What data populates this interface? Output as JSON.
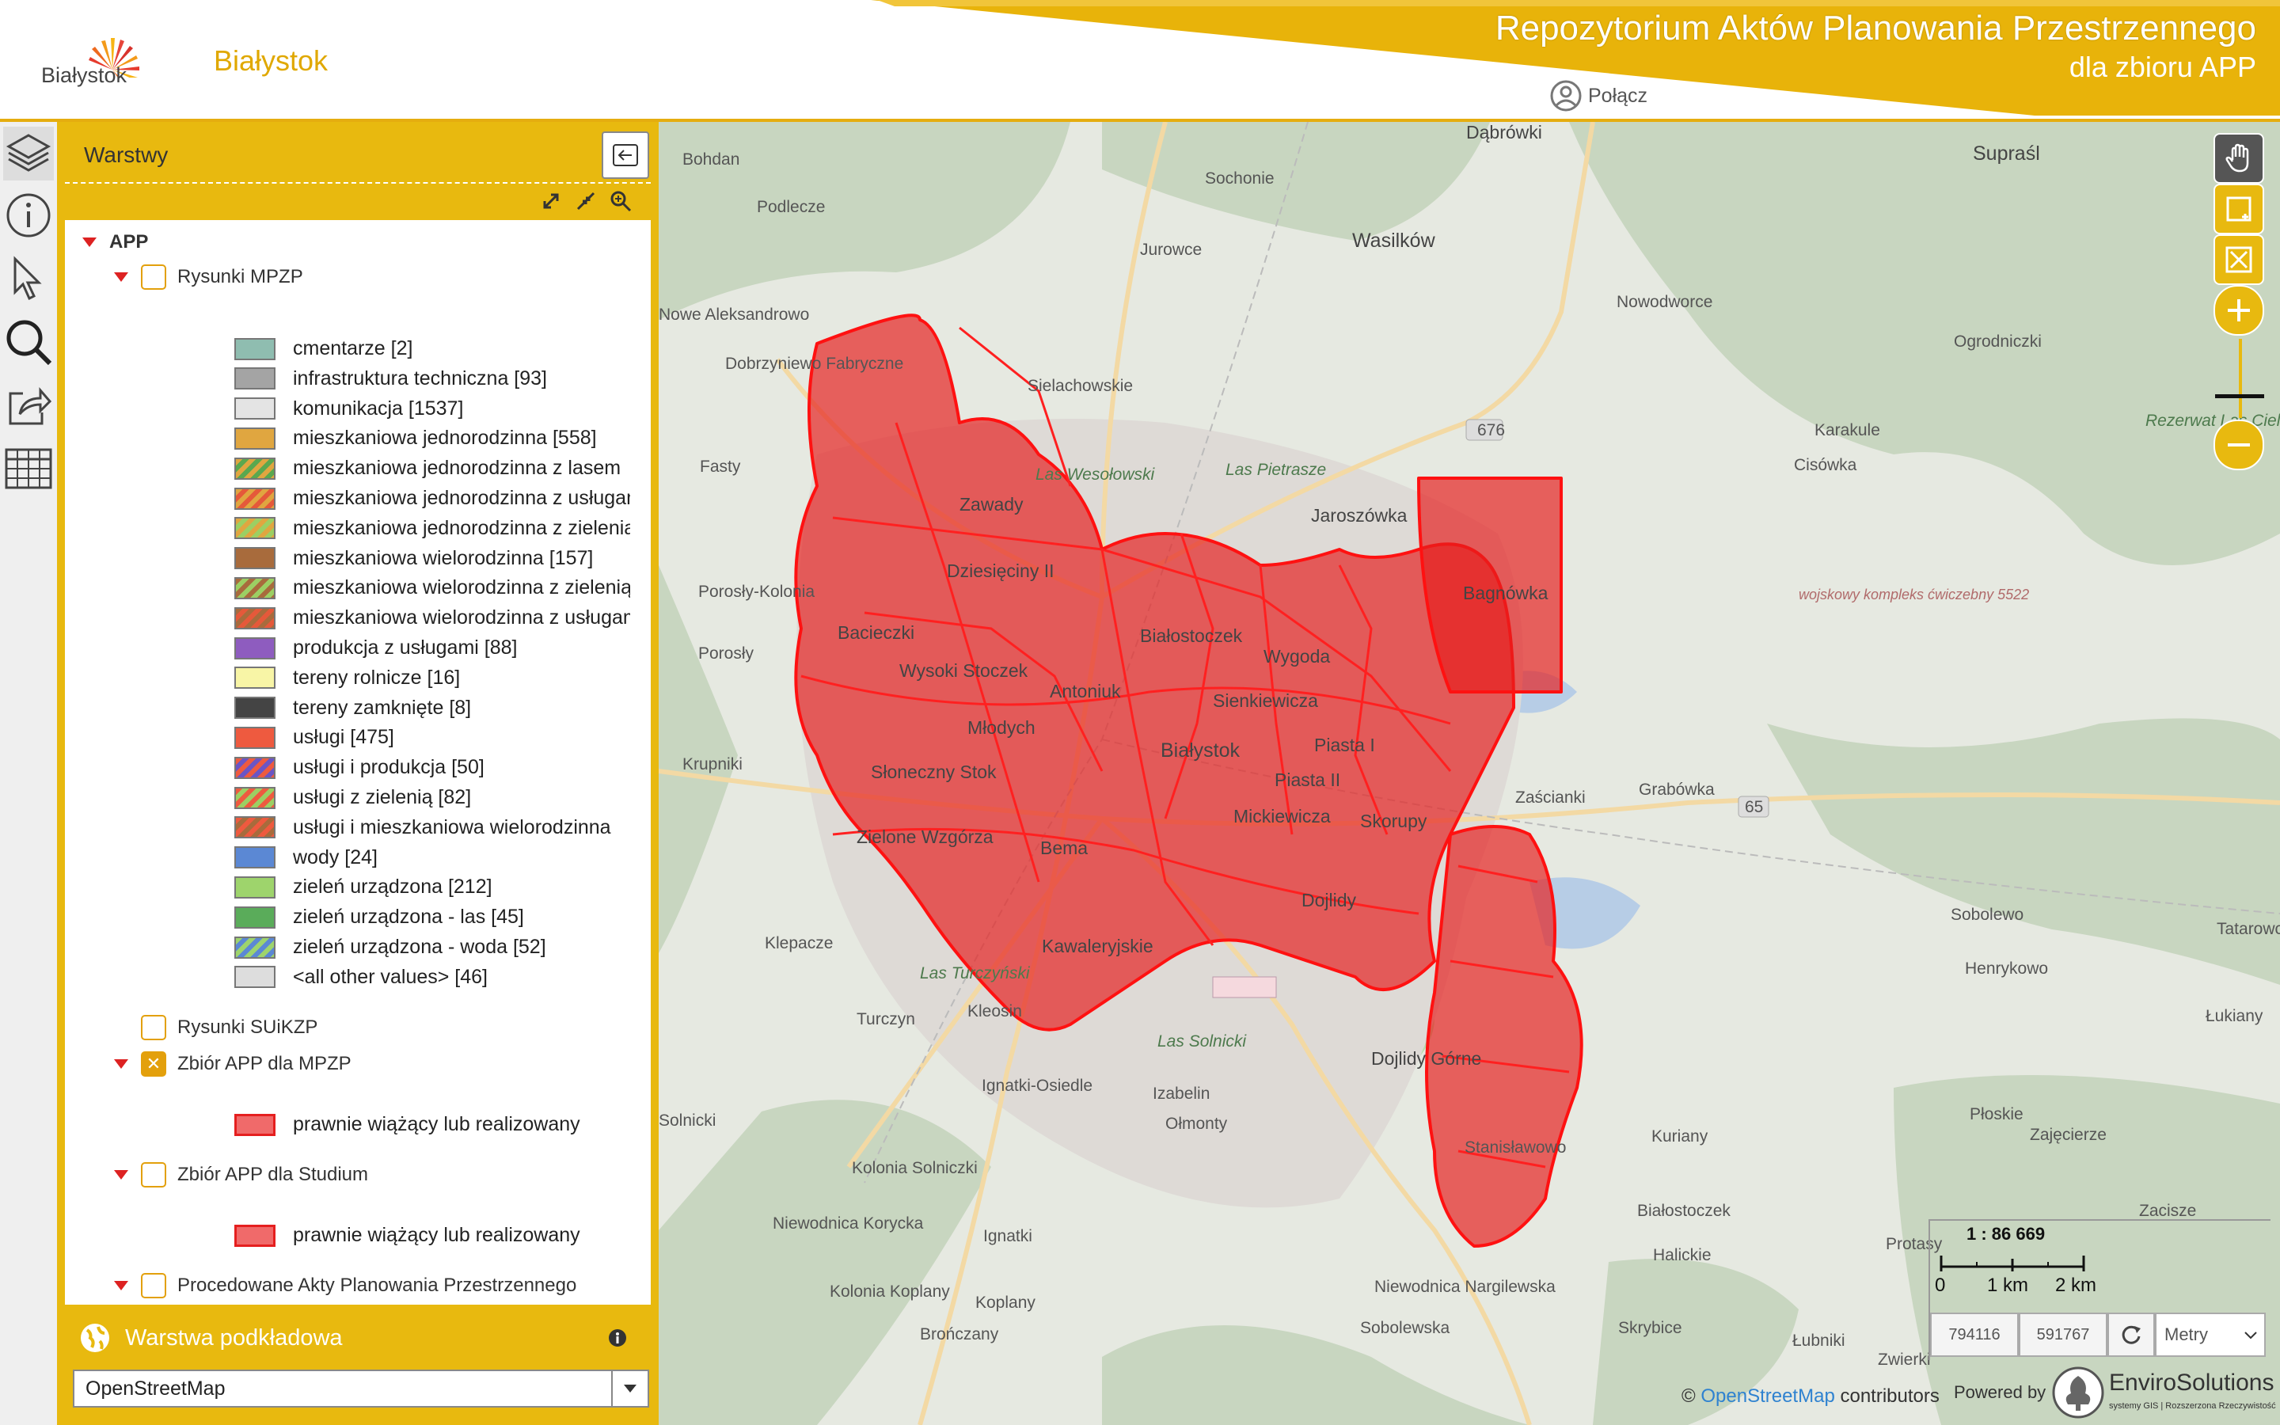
{
  "header": {
    "logo_text": "Białystok",
    "city_name": "Białystok",
    "title": "Repozytorium Aktów Planowania Przestrzennego",
    "subtitle": "dla zbioru APP",
    "login_label": "Połącz"
  },
  "toolbar": {
    "buttons": [
      "layers-icon",
      "info-icon",
      "select-icon",
      "search-icon",
      "share-icon",
      "table-icon"
    ]
  },
  "layers_panel": {
    "title": "Warstwy",
    "root": "APP",
    "groups": [
      {
        "label": "Rysunki MPZP",
        "checked": false,
        "expanded": true
      },
      {
        "label": "Rysunki SUiKZP",
        "checked": false,
        "expanded": false
      },
      {
        "label": "Zbiór APP dla MPZP",
        "checked": true,
        "expanded": true
      },
      {
        "label": "Zbiór APP dla Studium",
        "checked": false,
        "expanded": true
      },
      {
        "label": "Procedowane Akty Planowania Przestrzennego",
        "checked": false,
        "expanded": true
      }
    ],
    "legend_mpzp": [
      {
        "label": "cmentarze [2]",
        "color": "#8fbdb0"
      },
      {
        "label": "infrastruktura techniczna [93]",
        "color": "#a4a4a4"
      },
      {
        "label": "komunikacja [1537]",
        "color": "#e4e4e4"
      },
      {
        "label": "mieszkaniowa jednorodzinna [558]",
        "color": "#e0a640"
      },
      {
        "label": "mieszkaniowa jednorodzinna z lasem",
        "color": "#e0a640",
        "stripe": "#5aa84f"
      },
      {
        "label": "mieszkaniowa jednorodzinna z usługami",
        "color": "#e0a640",
        "stripe": "#e5593a"
      },
      {
        "label": "mieszkaniowa jednorodzinna z zielenią",
        "color": "#e0a640",
        "stripe": "#9ccf63"
      },
      {
        "label": "mieszkaniowa wielorodzinna [157]",
        "color": "#a86b3c"
      },
      {
        "label": "mieszkaniowa wielorodzinna z zielenią",
        "color": "#a86b3c",
        "stripe": "#9ccf63"
      },
      {
        "label": "mieszkaniowa wielorodzinna z usługami",
        "color": "#a86b3c",
        "stripe": "#e5593a"
      },
      {
        "label": "produkcja z usługami [88]",
        "color": "#8e5cbf"
      },
      {
        "label": "tereny rolnicze [16]",
        "color": "#f8f5a6"
      },
      {
        "label": "tereny zamknięte [8]",
        "color": "#444444"
      },
      {
        "label": "usługi [475]",
        "color": "#ee5a3f"
      },
      {
        "label": "usługi i produkcja [50]",
        "color": "#ee5a3f",
        "stripe": "#6b55c4"
      },
      {
        "label": "usługi z zielenią [82]",
        "color": "#ee5a3f",
        "stripe": "#9ccf63"
      },
      {
        "label": "usługi i mieszkaniowa wielorodzinna",
        "color": "#ee5a3f",
        "stripe": "#a86b3c"
      },
      {
        "label": "wody [24]",
        "color": "#5b88d4"
      },
      {
        "label": "zieleń urządzona [212]",
        "color": "#9ed46c"
      },
      {
        "label": "zieleń urządzona - las [45]",
        "color": "#5aac5a"
      },
      {
        "label": "zieleń urządzona - woda [52]",
        "color": "#9ed46c",
        "stripe": "#5b88d4"
      },
      {
        "label": "<all other values> [46]",
        "color": "#dddddd"
      }
    ],
    "legend_app_mpzp": {
      "label": "prawnie wiążący lub realizowany",
      "color": "#f06a6a"
    },
    "legend_app_studium": {
      "label": "prawnie wiążący lub realizowany",
      "color": "#f06a6a"
    }
  },
  "basemap": {
    "title": "Warstwa podkładowa",
    "selected": "OpenStreetMap"
  },
  "map": {
    "places": [
      "Dąbrówki",
      "Supraśl",
      "Bohdan",
      "Sochonie",
      "Podlecze",
      "Wasilków",
      "Jurowce",
      "Nowe Aleksandrowo",
      "Nowodworce",
      "Ogrodniczki",
      "Dobrzyniewo Fabryczne",
      "Sielachowskie",
      "Fasty",
      "Karakule",
      "Cisówka",
      "Las Wesołowski",
      "Las Pietrasze",
      "Jaroszówka",
      "Zawady",
      "Dziesięciny II",
      "Bagnówka",
      "Porosły-Kolonia",
      "Białostoczek",
      "Wygoda",
      "Bacieczki",
      "Porosły",
      "Wysoki Stoczek",
      "Antoniuk",
      "Sienkiewicza",
      "Młodych",
      "Białystok",
      "Piasta I",
      "Piasta II",
      "Krupniki",
      "Słoneczny Stok",
      "Zaścianki",
      "Grabówka",
      "Zielone Wzgórza",
      "Mickiewicza",
      "Skorupy",
      "Bema",
      "Sobolewo",
      "Tatarowce",
      "Klepacze",
      "Dojlidy",
      "Kawaleryjskie",
      "Henrykowo",
      "Las Turczyński",
      "Kleosin",
      "Łukiany",
      "Turczyn",
      "Las Solnicki",
      "Dojlidy Górne",
      "Ignatki-Osiedle",
      "Izabelin",
      "Płoskie",
      "Solnicki",
      "Ołmonty",
      "Kuriany",
      "Zajęcierze",
      "Stanisławowo",
      "Kolonia Solniczki",
      "Zacisze",
      "Białostoczek",
      "Halickie",
      "Protasy",
      "Niewodnica Korycka",
      "Ignatki",
      "Kolonia Koplany",
      "Niewodnica Nargilewska",
      "Koplany",
      "Sobolewska",
      "Brończany",
      "Skrybice",
      "Łubniki",
      "Zwierki",
      "Rezerwat Las Cieliczanski",
      "wojskowy kompleks ćwiczebny 5522"
    ],
    "road_numbers": [
      "676",
      "65"
    ]
  },
  "scale": {
    "ratio": "1 : 86 669",
    "labels": [
      "0",
      "1 km",
      "2 km"
    ],
    "coord_x": "794116",
    "coord_y": "591767",
    "units": "Metry"
  },
  "attribution": {
    "prefix": "©",
    "link": "OpenStreetMap",
    "suffix": "contributors",
    "powered": "Powered by",
    "company": "EnviroSolutions",
    "company_tag": "systemy GIS | Rozszerzona Rzeczywistość"
  }
}
